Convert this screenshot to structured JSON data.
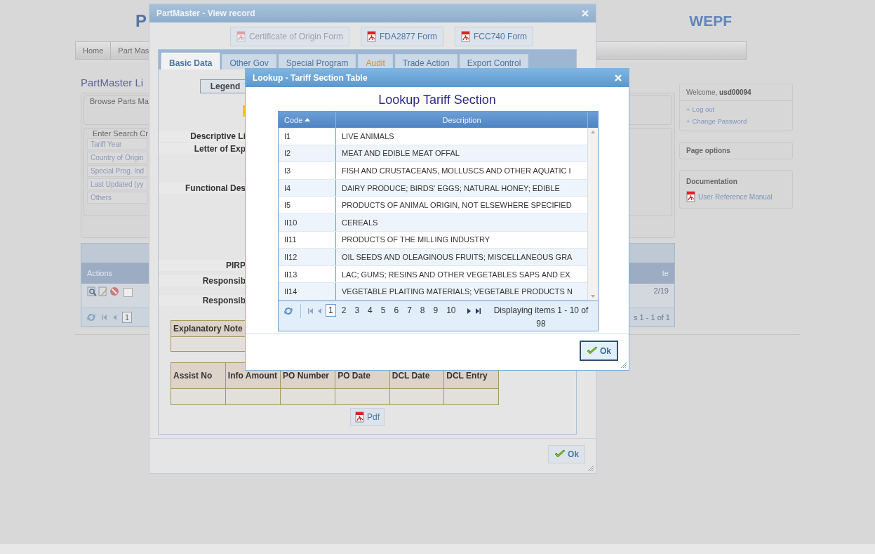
{
  "page": {
    "logo_left": "P",
    "logo_right": "WEPF",
    "nav": [
      {
        "label": "Home"
      },
      {
        "label": "Part Mas"
      }
    ],
    "title": "PartMaster Li",
    "browse_legend": "Browse Parts Ma",
    "search_legend": "Enter Search Cr",
    "search_fields": [
      "Tariff Year",
      "Country of Origin",
      "Special Prog. Ind",
      "Last Updated (yy",
      "Others"
    ],
    "grid": {
      "column": "Actions",
      "column_fragment": "te",
      "row_checked": false,
      "cell_fragment": "2/19",
      "page": "1",
      "pager_fragment": "s 1 - 1 of 1"
    },
    "user_panel": {
      "welcome": "Welcome, **usd00094**",
      "links": [
        {
          "bullet": "+",
          "label": "Log out"
        },
        {
          "bullet": "+",
          "label": "Change Password"
        }
      ]
    },
    "page_options": "Page options",
    "documentation": {
      "title": "Documentation",
      "link": "User Reference Manual"
    }
  },
  "record_dialog": {
    "title": "PartMaster - View record",
    "form_buttons": [
      {
        "label": "Certificate of Origin Form",
        "disabled": true
      },
      {
        "label": "FDA2877 Form",
        "disabled": false
      },
      {
        "label": "FCC740 Form",
        "disabled": false
      }
    ],
    "tabs": [
      {
        "label": "Basic Data",
        "selected": true,
        "modified": false
      },
      {
        "label": "Other Gov",
        "selected": false,
        "modified": false
      },
      {
        "label": "Special Program",
        "selected": false,
        "modified": false
      },
      {
        "label": "Audit",
        "selected": false,
        "modified": true
      },
      {
        "label": "Trade Action",
        "selected": false,
        "modified": false
      },
      {
        "label": "Export Control",
        "selected": false,
        "modified": false
      }
    ],
    "legend_button": "Legend",
    "fields": [
      {
        "label": "Descriptive Li"
      },
      {
        "label": "Letter of Exp"
      },
      {
        "label": "Functional Des"
      },
      {
        "label": "PIRP"
      },
      {
        "label": "Responsib"
      },
      {
        "label": "Responsib"
      }
    ],
    "note_header": "Explanatory Note",
    "assist_columns": [
      "Assist No",
      "Info Amount",
      "PO Number",
      "PO Date",
      "DCL Date",
      "DCL Entry"
    ],
    "pdf_button": "Pdf",
    "ok_button": "Ok"
  },
  "lookup_dialog": {
    "title": "Lookup - Tariff Section Table",
    "heading": "Lookup Tariff Section",
    "columns": [
      {
        "label": "Code",
        "sorted_ascending": true
      },
      {
        "label": "Description",
        "sorted_ascending": false
      }
    ],
    "rows": [
      {
        "code": "I1",
        "description": "LIVE ANIMALS"
      },
      {
        "code": "I2",
        "description": "MEAT AND EDIBLE MEAT OFFAL"
      },
      {
        "code": "I3",
        "description": "FISH AND CRUSTACEANS, MOLLUSCS AND OTHER AQUATIC I"
      },
      {
        "code": "I4",
        "description": "DAIRY PRODUCE; BIRDS' EGGS; NATURAL HONEY; EDIBLE"
      },
      {
        "code": "I5",
        "description": "PRODUCTS OF ANIMAL ORIGIN, NOT ELSEWHERE SPECIFIED"
      },
      {
        "code": "II10",
        "description": "CEREALS"
      },
      {
        "code": "II11",
        "description": "PRODUCTS OF THE MILLING INDUSTRY"
      },
      {
        "code": "II12",
        "description": "OIL SEEDS AND OLEAGINOUS FRUITS; MISCELLANEOUS GRA"
      },
      {
        "code": "II13",
        "description": "LAC; GUMS; RESINS AND OTHER VEGETABLES SAPS AND EX"
      },
      {
        "code": "II14",
        "description": "VEGETABLE PLAITING MATERIALS; VEGETABLE PRODUCTS N"
      }
    ],
    "pages": [
      {
        "label": "1",
        "selected": true
      },
      {
        "label": "2",
        "selected": false
      },
      {
        "label": "3",
        "selected": false
      },
      {
        "label": "4",
        "selected": false
      },
      {
        "label": "5",
        "selected": false
      },
      {
        "label": "6",
        "selected": false
      },
      {
        "label": "7",
        "selected": false
      },
      {
        "label": "8",
        "selected": false
      },
      {
        "label": "9",
        "selected": false
      },
      {
        "label": "10",
        "selected": false
      }
    ],
    "pager_info": "Displaying items 1 - 10 of 98",
    "ok_button": "Ok"
  }
}
